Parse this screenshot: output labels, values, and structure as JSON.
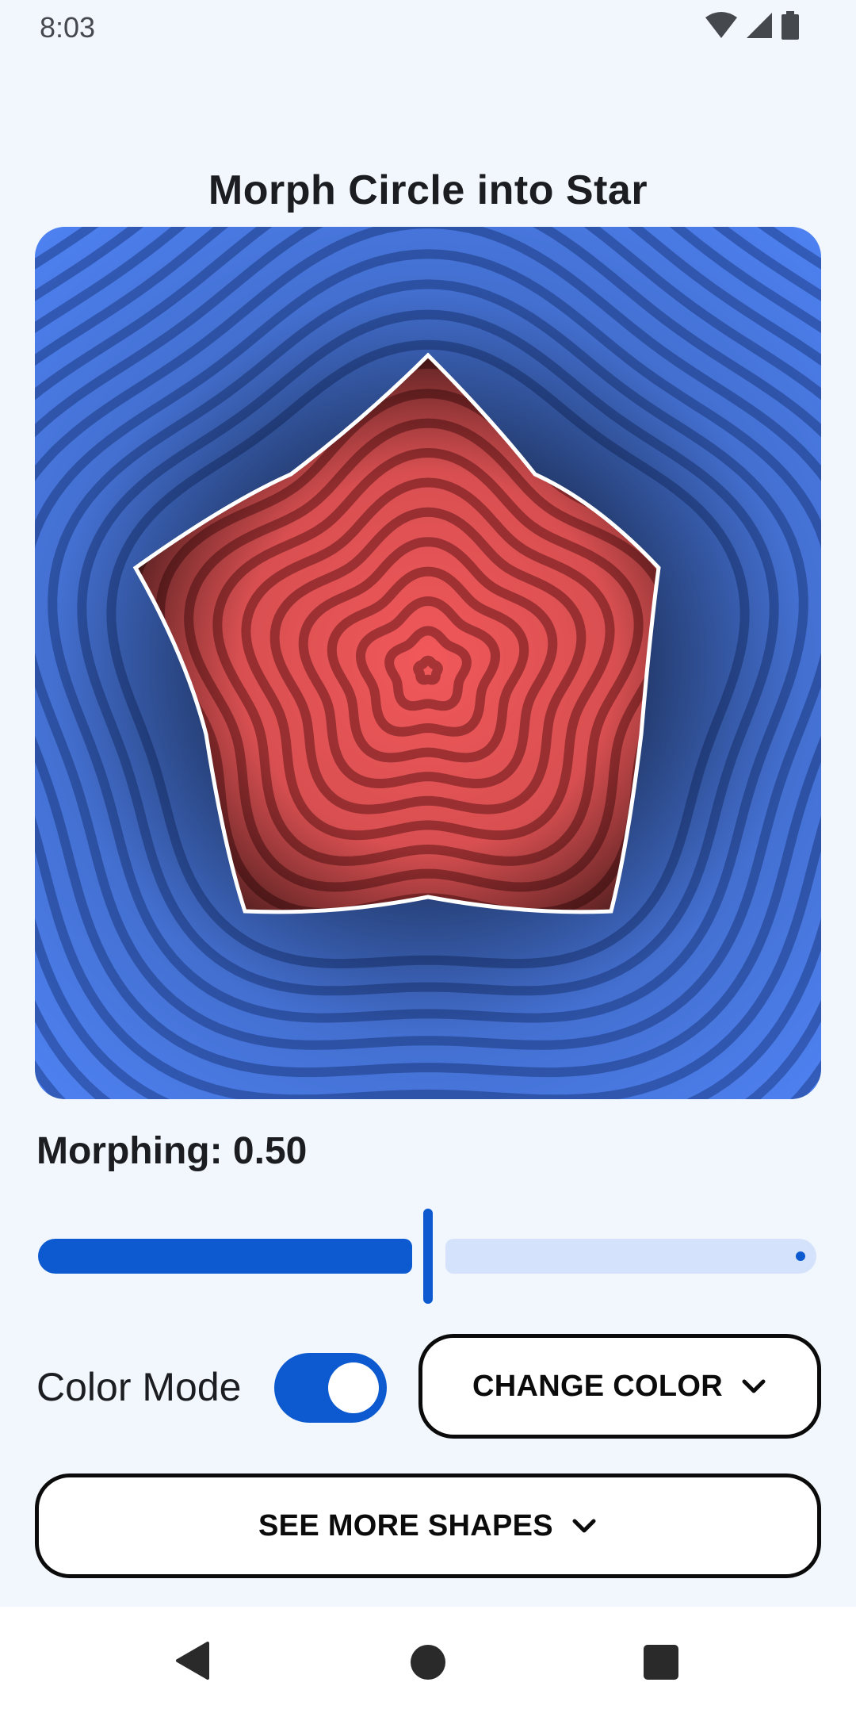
{
  "status_bar": {
    "time": "8:03",
    "icons": [
      "wifi-icon",
      "cellular-icon",
      "battery-icon"
    ]
  },
  "title": "Morph Circle into Star",
  "canvas": {
    "shape_from": "circle",
    "shape_to": "star",
    "morph_progress": 0.5,
    "background_color": "#4f83f5",
    "shape_color": "#f1585a",
    "outline_color": "#ffffff"
  },
  "morphing": {
    "label": "Morphing: 0.50",
    "value": 0.5,
    "min": 0,
    "max": 1
  },
  "color_mode": {
    "label": "Color Mode",
    "enabled": true
  },
  "buttons": {
    "change_color": "CHANGE COLOR",
    "see_more_shapes": "SEE MORE SHAPES"
  },
  "accent_color": "#0d5ad0",
  "nav_bar": {
    "icons": [
      "back-icon",
      "home-icon",
      "recents-icon"
    ]
  }
}
